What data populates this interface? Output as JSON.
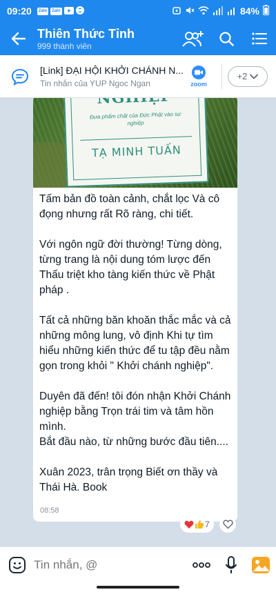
{
  "status_bar": {
    "time": "09:20",
    "app_icons": [
      "Zalo",
      "Zalo",
      "youtube-icon",
      "shazam-icon"
    ],
    "battery": "84%"
  },
  "header": {
    "group_name": "Thiên Thức Tỉnh",
    "member_count": "999 thành viên"
  },
  "pinned": {
    "title": "[Link] ĐẠI HỘI KHỞI CHÁNH N...",
    "subtitle": "Tin nhắn của YUP Ngoc Ngan",
    "badge_label": "zoom",
    "more_count": "+2"
  },
  "message": {
    "image": {
      "book_title": "NGHIỆP",
      "book_subtitle": "Đưa phẩm chất của Đức Phật vào sự nghiệp",
      "book_author": "TẠ MINH TUẤN"
    },
    "paragraphs": [
      "Tấm bản đồ toàn cảnh, chắt lọc Và cô đọng nhưng rất Rõ ràng, chi tiết.",
      "Với ngôn ngữ đời thường! Từng dòng, từng trang là nội dung tóm lược đến Thấu triệt kho tàng kiến thức về Phật pháp .",
      "Tất cả những băn khoăn thắc mắc và cả những mông lung, vô định Khi tự tìm hiểu những kiến thức để tu tập đều nằm gọn trong khỏi \" Khởi chánh nghiệp\".",
      "Duyên đã đến! tôi đón nhận Khởi Chánh nghiệp bằng Trọn trái tim và tâm hồn mình.\nBắt đầu nào, từ những bước đầu tiên....",
      "Xuân 2023, trân trọng Biết ơn thầy và Thái Hà. Book"
    ],
    "time": "08:58",
    "reaction_count": "7",
    "reaction_icons": [
      "heart-icon",
      "thumbs-up-icon"
    ]
  },
  "input": {
    "placeholder": "Tin nhắn, @"
  },
  "colors": {
    "brand": "#1f88ee",
    "chat_bg": "#d3dee9",
    "book_green": "#2f8e7b"
  }
}
